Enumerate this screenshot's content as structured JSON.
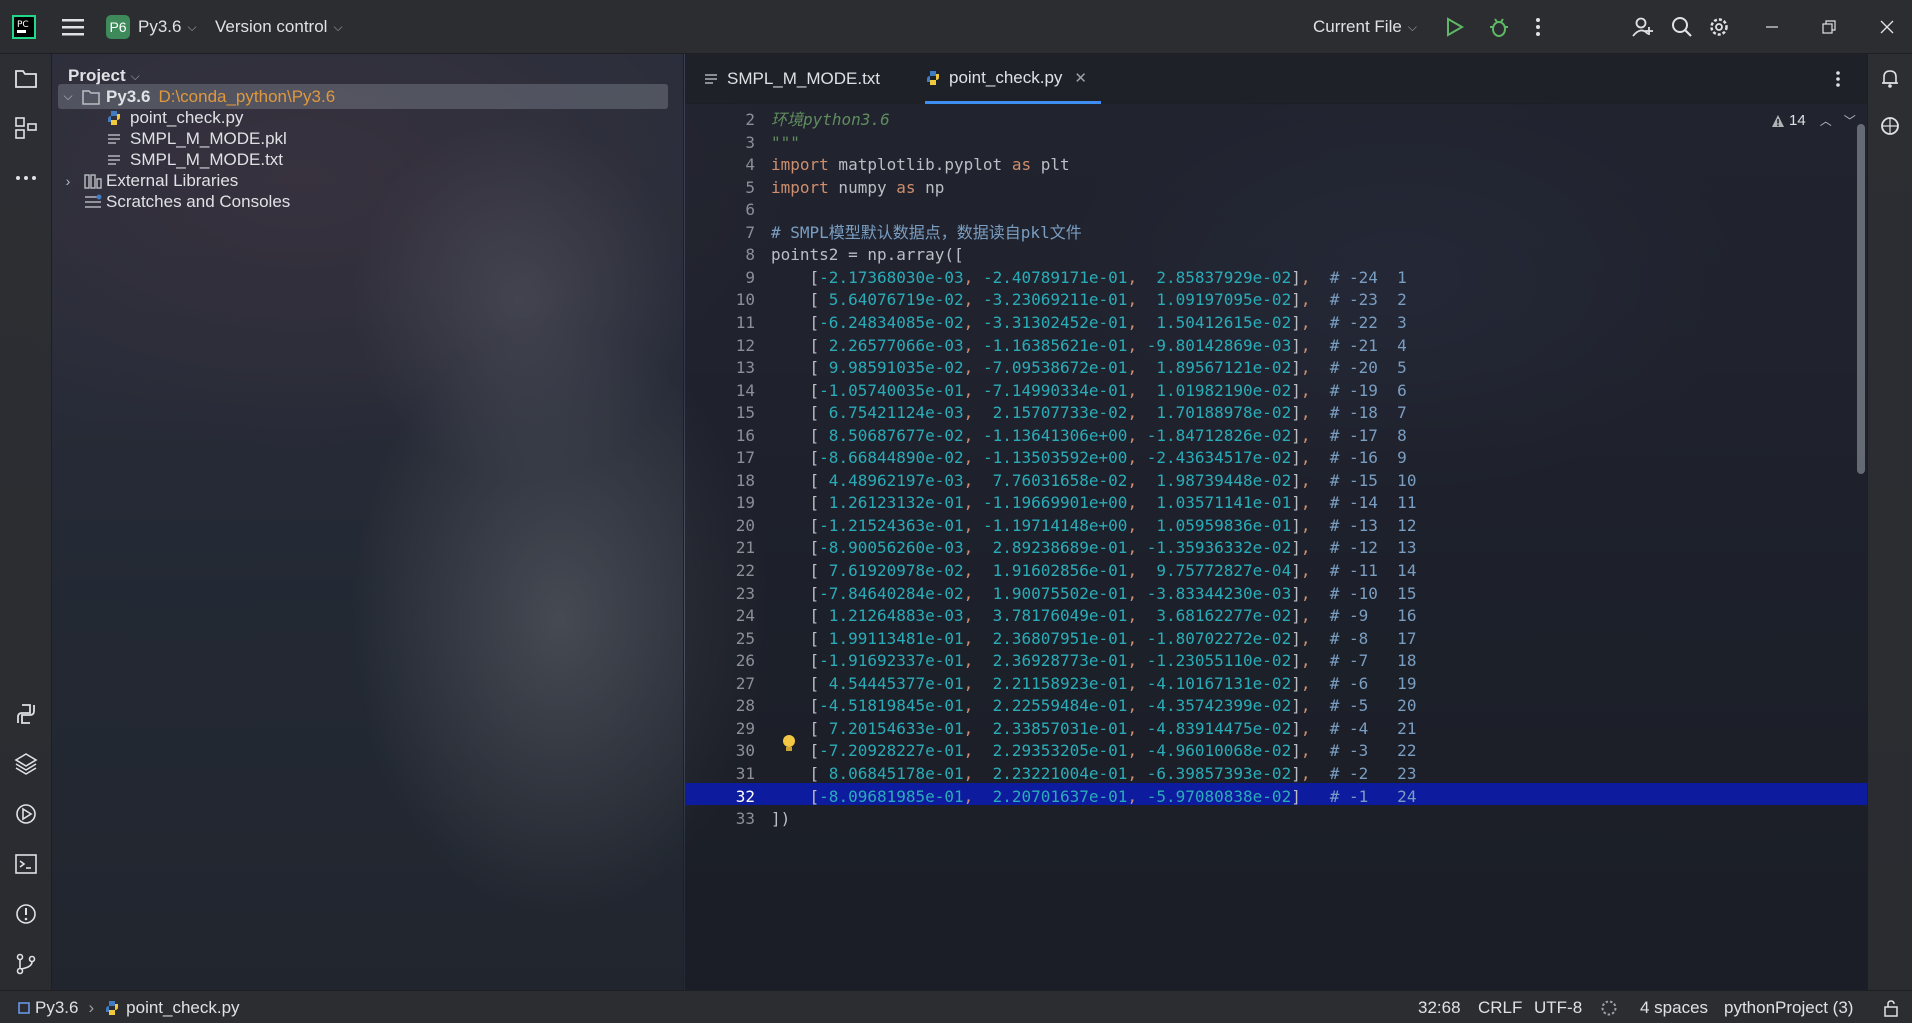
{
  "topbar": {
    "project_badge": "P6",
    "project_name": "Py3.6",
    "vcs": "Version control",
    "run_config": "Current File"
  },
  "left_toolbar": {
    "icons": [
      "folder-icon",
      "structure-icon",
      "more-icon",
      "python-console-icon",
      "layers-icon",
      "services-icon",
      "terminal-icon",
      "problems-icon",
      "git-icon"
    ]
  },
  "project": {
    "title": "Project",
    "root_name": "Py3.6",
    "root_path": "D:\\conda_python\\Py3.6",
    "files": [
      "point_check.py",
      "SMPL_M_MODE.pkl",
      "SMPL_M_MODE.txt"
    ],
    "external": "External Libraries",
    "scratches": "Scratches and Consoles"
  },
  "tabs": [
    {
      "label": "SMPL_M_MODE.txt"
    },
    {
      "label": "point_check.py"
    }
  ],
  "editor": {
    "warnings": "14",
    "header_lines": [
      {
        "n": "2",
        "text": "环境python3.6"
      },
      {
        "n": "3",
        "text": "\"\"\""
      },
      {
        "n": "4",
        "kw1": "import",
        "mid": " matplotlib.pyplot ",
        "kw2": "as",
        "tail": " plt"
      },
      {
        "n": "5",
        "kw1": "import",
        "mid": " numpy ",
        "kw2": "as",
        "tail": " np"
      },
      {
        "n": "6",
        "text": ""
      },
      {
        "n": "7",
        "text": "# SMPL模型默认数据点，数据读自pkl文件"
      },
      {
        "n": "8",
        "text": "points2 = np.array(["
      }
    ],
    "rows": [
      {
        "n": "9",
        "a": "-2.17368030e-03",
        "b": "-2.40789171e-01",
        "c": " 2.85837929e-02",
        "sep": ",",
        "c1": "-24",
        "c2": "1"
      },
      {
        "n": "10",
        "a": " 5.64076719e-02",
        "b": "-3.23069211e-01",
        "c": " 1.09197095e-02",
        "sep": ",",
        "c1": "-23",
        "c2": "2"
      },
      {
        "n": "11",
        "a": "-6.24834085e-02",
        "b": "-3.31302452e-01",
        "c": " 1.50412615e-02",
        "sep": ",",
        "c1": "-22",
        "c2": "3"
      },
      {
        "n": "12",
        "a": " 2.26577066e-03",
        "b": "-1.16385621e-01",
        "c": "-9.80142869e-03",
        "sep": ",",
        "c1": "-21",
        "c2": "4"
      },
      {
        "n": "13",
        "a": " 9.98591035e-02",
        "b": "-7.09538672e-01",
        "c": " 1.89567121e-02",
        "sep": ",",
        "c1": "-20",
        "c2": "5"
      },
      {
        "n": "14",
        "a": "-1.05740035e-01",
        "b": "-7.14990334e-01",
        "c": " 1.01982190e-02",
        "sep": ",",
        "c1": "-19",
        "c2": "6"
      },
      {
        "n": "15",
        "a": " 6.75421124e-03",
        "b": " 2.15707733e-02",
        "c": " 1.70188978e-02",
        "sep": ",",
        "c1": "-18",
        "c2": "7"
      },
      {
        "n": "16",
        "a": " 8.50687677e-02",
        "b": "-1.13641306e+00",
        "c": "-1.84712826e-02",
        "sep": ",",
        "c1": "-17",
        "c2": "8"
      },
      {
        "n": "17",
        "a": "-8.66844890e-02",
        "b": "-1.13503592e+00",
        "c": "-2.43634517e-02",
        "sep": ",",
        "c1": "-16",
        "c2": "9"
      },
      {
        "n": "18",
        "a": " 4.48962197e-03",
        "b": " 7.76031658e-02",
        "c": " 1.98739448e-02",
        "sep": ",",
        "c1": "-15",
        "c2": "10"
      },
      {
        "n": "19",
        "a": " 1.26123132e-01",
        "b": "-1.19669901e+00",
        "c": " 1.03571141e-01",
        "sep": ",",
        "c1": "-14",
        "c2": "11"
      },
      {
        "n": "20",
        "a": "-1.21524363e-01",
        "b": "-1.19714148e+00",
        "c": " 1.05959836e-01",
        "sep": ",",
        "c1": "-13",
        "c2": "12"
      },
      {
        "n": "21",
        "a": "-8.90056260e-03",
        "b": " 2.89238689e-01",
        "c": "-1.35936332e-02",
        "sep": ",",
        "c1": "-12",
        "c2": "13"
      },
      {
        "n": "22",
        "a": " 7.61920978e-02",
        "b": " 1.91602856e-01",
        "c": " 9.75772827e-04",
        "sep": ",",
        "c1": "-11",
        "c2": "14"
      },
      {
        "n": "23",
        "a": "-7.84640284e-02",
        "b": " 1.90075502e-01",
        "c": "-3.83344230e-03",
        "sep": ",",
        "c1": "-10",
        "c2": "15"
      },
      {
        "n": "24",
        "a": " 1.21264883e-03",
        "b": " 3.78176049e-01",
        "c": " 3.68162277e-02",
        "sep": ",",
        "c1": "-9",
        "c2": "16"
      },
      {
        "n": "25",
        "a": " 1.99113481e-01",
        "b": " 2.36807951e-01",
        "c": "-1.80702272e-02",
        "sep": ",",
        "c1": "-8",
        "c2": "17"
      },
      {
        "n": "26",
        "a": "-1.91692337e-01",
        "b": " 2.36928773e-01",
        "c": "-1.23055110e-02",
        "sep": ",",
        "c1": "-7",
        "c2": "18"
      },
      {
        "n": "27",
        "a": " 4.54445377e-01",
        "b": " 2.21158923e-01",
        "c": "-4.10167131e-02",
        "sep": ",",
        "c1": "-6",
        "c2": "19"
      },
      {
        "n": "28",
        "a": "-4.51819845e-01",
        "b": " 2.22559484e-01",
        "c": "-4.35742399e-02",
        "sep": ",",
        "c1": "-5",
        "c2": "20"
      },
      {
        "n": "29",
        "a": " 7.20154633e-01",
        "b": " 2.33857031e-01",
        "c": "-4.83914475e-02",
        "sep": ",",
        "c1": "-4",
        "c2": "21"
      },
      {
        "n": "30",
        "a": "-7.20928227e-01",
        "b": " 2.29353205e-01",
        "c": "-4.96010068e-02",
        "sep": ",",
        "c1": "-3",
        "c2": "22"
      },
      {
        "n": "31",
        "a": " 8.06845178e-01",
        "b": " 2.23221004e-01",
        "c": "-6.39857393e-02",
        "sep": ",",
        "c1": "-2",
        "c2": "23"
      },
      {
        "n": "32",
        "a": "-8.09681985e-01",
        "b": " 2.20701637e-01",
        "c": "-5.97080838e-02",
        "sep": " ",
        "c1": "-1",
        "c2": "24"
      }
    ],
    "footer_lines": [
      {
        "n": "33",
        "text": "])"
      }
    ]
  },
  "statusbar": {
    "crumb_project": "Py3.6",
    "crumb_file": "point_check.py",
    "position": "32:68",
    "line_sep": "CRLF",
    "encoding": "UTF-8",
    "indent": "4 spaces",
    "interpreter": "pythonProject (3)"
  }
}
